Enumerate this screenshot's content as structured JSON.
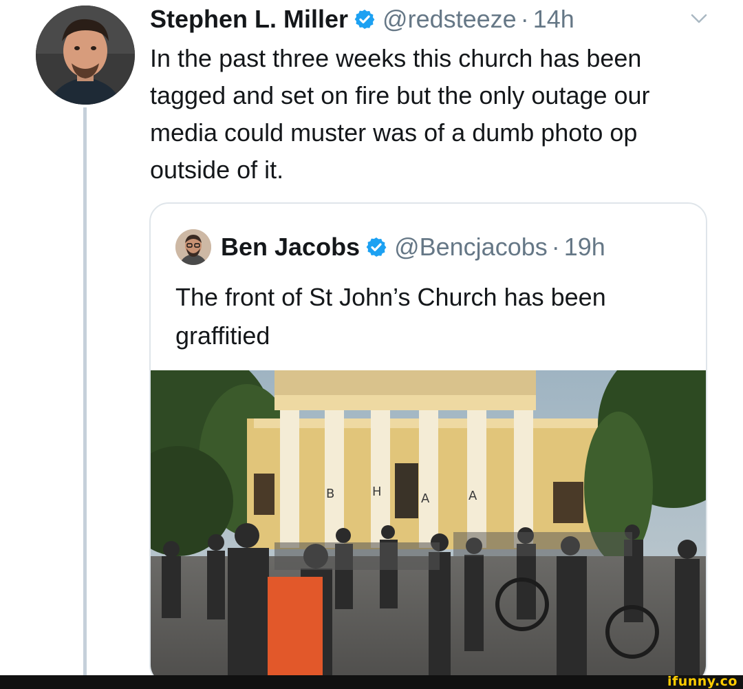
{
  "tweet": {
    "author_name": "Stephen L. Miller",
    "handle": "@redsteeze",
    "separator": "·",
    "time": "14h",
    "text": "In the past three weeks this church has been tagged and set on fire but the only outage our media could muster was of a dumb photo op outside of it."
  },
  "quoted_tweet": {
    "author_name": "Ben Jacobs",
    "handle": "@Bencjacobs",
    "separator": "·",
    "time": "19h",
    "text": "The front of St John’s Church has been graffitied",
    "photo_graffiti": [
      "B",
      "H",
      "A",
      "A"
    ]
  },
  "icons": {
    "verified": "verified-badge-icon",
    "more": "chevron-down-icon"
  },
  "colors": {
    "verified_blue": "#1da1f2",
    "secondary_text": "#657786",
    "thread_line": "#c5d0da",
    "card_border": "#dfe5ea",
    "watermark": "#ffcc00"
  },
  "watermark": {
    "text": "ifunny.co"
  }
}
